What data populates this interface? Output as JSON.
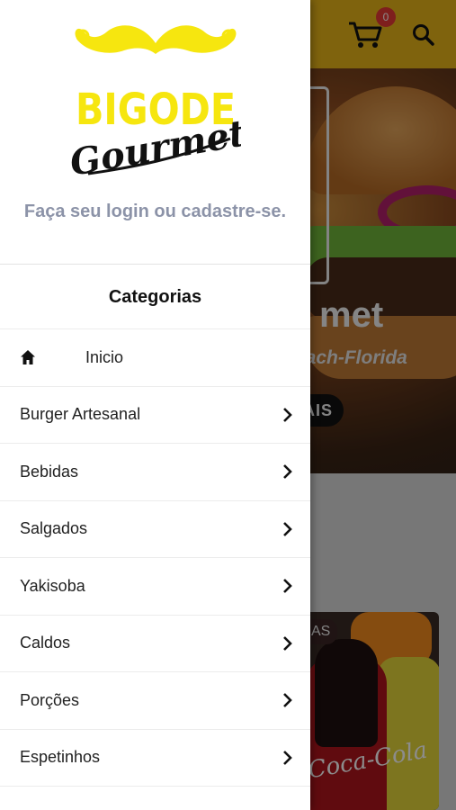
{
  "background": {
    "cart_count": "0",
    "banner": {
      "title": "met",
      "subtitle": "each-Florida",
      "button_label": "AIS"
    },
    "product_card": {
      "tag": "AS",
      "bottle_text": "Coca-Cola"
    }
  },
  "drawer": {
    "logo": {
      "line1": "BIGODE",
      "line2": "Gourmet"
    },
    "login_prompt": "Faça seu login ou cadastre-se.",
    "section_title": "Categorias",
    "home": {
      "label": "Inicio",
      "icon": "home-icon"
    },
    "categories": [
      {
        "label": "Burger Artesanal"
      },
      {
        "label": "Bebidas"
      },
      {
        "label": "Salgados"
      },
      {
        "label": "Yakisoba"
      },
      {
        "label": "Caldos"
      },
      {
        "label": "Porções"
      },
      {
        "label": "Espetinhos"
      }
    ]
  },
  "colors": {
    "brand_yellow": "#f6e60f",
    "topbar_yellow": "#e8b419",
    "login_text": "#8c93a8",
    "badge_red": "#e53935"
  }
}
